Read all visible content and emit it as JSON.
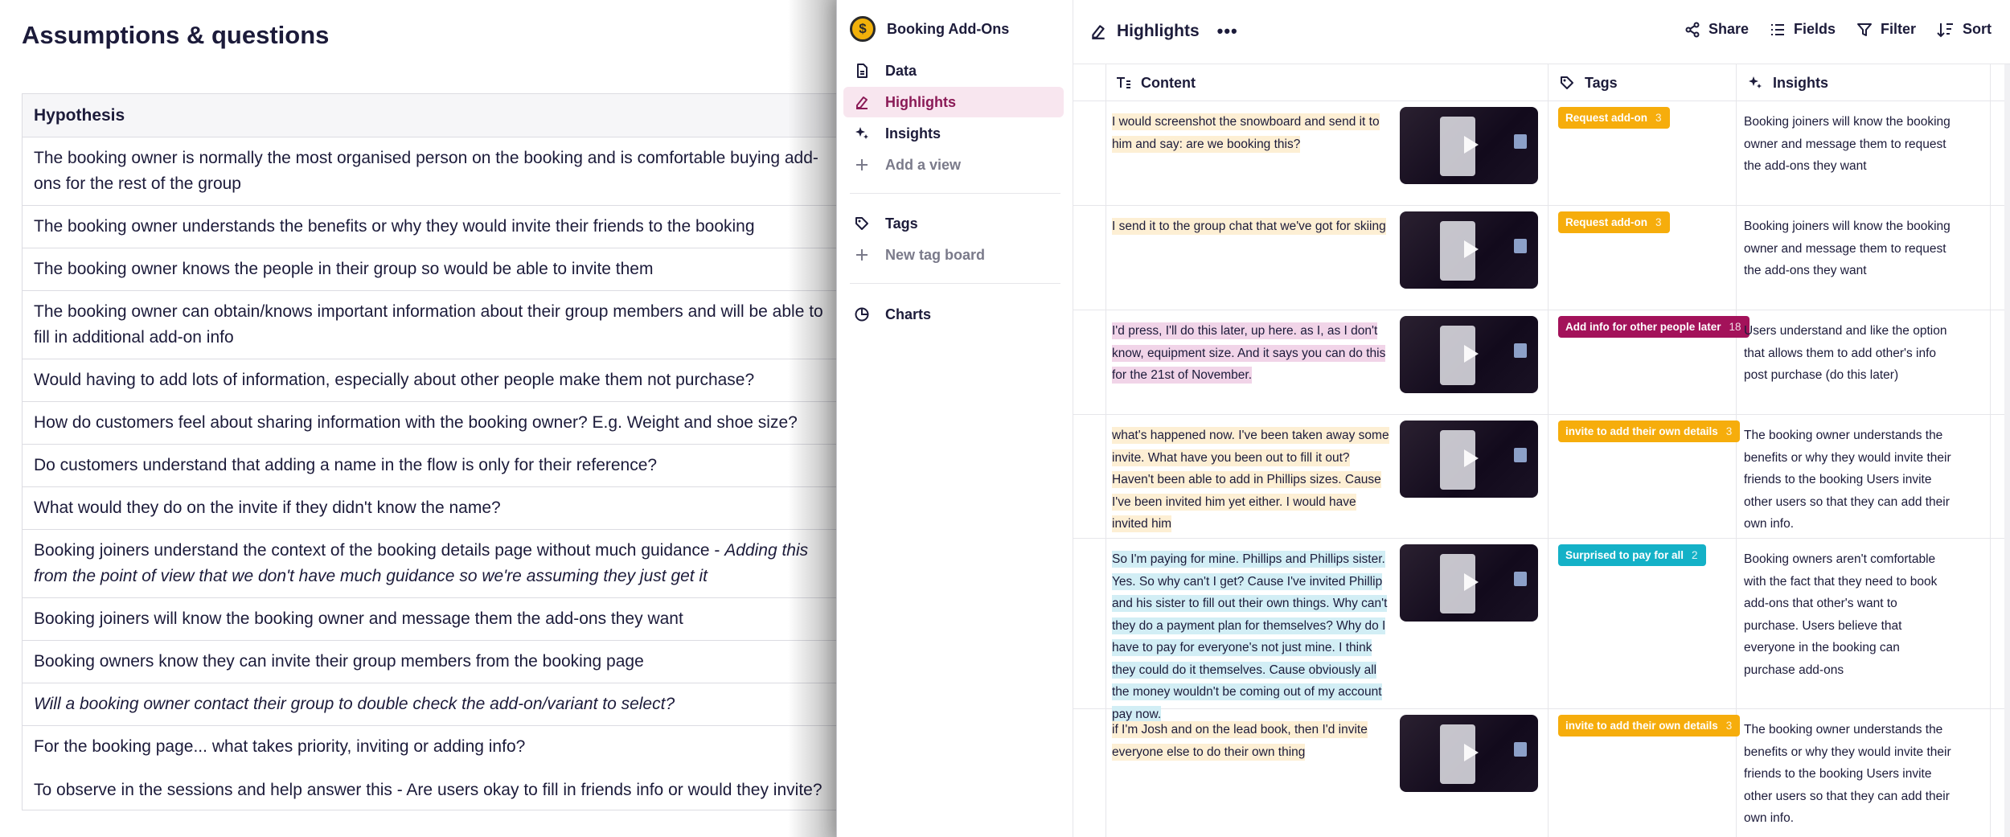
{
  "doc": {
    "title": "Assumptions & questions",
    "table_header": "Hypothesis",
    "rows": [
      {
        "text": "The booking owner is normally the most organised person on the booking and is comfortable buying add-ons for the rest of the group"
      },
      {
        "text": "The booking owner understands the benefits or why they would invite their friends to the booking"
      },
      {
        "text": "The booking owner knows the people in their group so would be able to invite them"
      },
      {
        "text": "The booking owner can obtain/knows important information about their group members and will be able to fill in additional add-on info"
      },
      {
        "text": "Would having to add lots of information, especially about other people make them not purchase?"
      },
      {
        "text": "How do customers feel about sharing information with the booking owner? E.g. Weight and shoe size?"
      },
      {
        "text": "Do customers understand that adding a name in the flow is only for their reference?"
      },
      {
        "text": "What would they do on the invite if they didn't know the name?"
      },
      {
        "text": "Booking joiners understand the context of the booking details page without much guidance - ",
        "em": "Adding this from the point of view that we don't have much guidance so we're assuming they just get it"
      },
      {
        "text": "Booking joiners will know the booking owner and message them the add-ons they want"
      },
      {
        "text": "Booking owners know they can invite their group members from the booking page"
      },
      {
        "text": "Will a booking owner contact their group to double check the add-on/variant to select?",
        "italic": true
      },
      {
        "text": "For the booking page... what takes priority, inviting or adding info?",
        "extra": "To observe in the sessions and help answer this - Are users okay to fill in friends info or would they invite?"
      }
    ]
  },
  "app": {
    "workspace": {
      "logo_glyph": "$",
      "name": "Booking Add-Ons"
    },
    "nav": [
      {
        "label": "Data",
        "icon": "document-icon"
      },
      {
        "label": "Highlights",
        "icon": "highlighter-icon",
        "active": true
      },
      {
        "label": "Insights",
        "icon": "sparkle-icon"
      },
      {
        "label": "Add a view",
        "icon": "plus-icon",
        "muted": true
      }
    ],
    "nav2": [
      {
        "label": "Tags",
        "icon": "tag-icon"
      },
      {
        "label": "New tag board",
        "icon": "plus-icon",
        "muted": true
      }
    ],
    "nav3": [
      {
        "label": "Charts",
        "icon": "pie-chart-icon"
      }
    ],
    "view": {
      "title": "Highlights",
      "more": "•••"
    },
    "actions": {
      "share": "Share",
      "fields": "Fields",
      "filter": "Filter",
      "sort": "Sort"
    },
    "columns": {
      "content": "Content",
      "tags": "Tags",
      "insights": "Insights"
    },
    "highlights": [
      {
        "content": "I would screenshot the snowboard and send it to him and say: are we booking this?",
        "color": "yellow",
        "tag": "Request add-on",
        "tag_count": "3",
        "tag_color": "#f6ad0c",
        "insight": "Booking joiners will know the booking owner and message them to request the add-ons they want"
      },
      {
        "content": "I send it to the group chat that we've got for skiing",
        "color": "yellow",
        "tag": "Request add-on",
        "tag_count": "3",
        "tag_color": "#f6ad0c",
        "insight": "Booking joiners will know the booking owner and message them to request the add-ons they want"
      },
      {
        "content": "I'd press, I'll do this later, up here. as I, as I don't know, equipment size. And it says you can do this for the 21st of November.",
        "color": "pink",
        "tag": "Add info for other people later",
        "tag_count": "18",
        "tag_color": "#a3125a",
        "insight": "Users understand and like the option that allows them to add other's info post purchase (do this later)"
      },
      {
        "content": "what's happened now. I've been taken away some invite. What have you been out to fill it out? Haven't been able to add in Phillips sizes. Cause I've been invited him yet either. I would have invited him",
        "color": "yellow",
        "tag": "invite to add their own details",
        "tag_count": "3",
        "tag_color": "#f6ad0c",
        "insight": "The booking owner understands the benefits or why they would invite their friends to the booking Users invite other users so that they can add their own info."
      },
      {
        "content": "So I'm paying for mine. Phillips and Phillips sister. Yes. So why can't I get? Cause I've invited Phillip and his sister to fill out their own things. Why can't they do a payment plan for themselves? Why do I have to pay for everyone's not just mine. I think they could do it themselves. Cause obviously all the money wouldn't be coming out of my account pay now.",
        "color": "blue",
        "tag": "Surprised to pay for all",
        "tag_count": "2",
        "tag_color": "#14b1c7",
        "insight": "Booking owners aren't comfortable with the fact that they need to book add-ons that other's want to purchase. Users believe that everyone in the booking can purchase add-ons"
      },
      {
        "content": "if I'm Josh and on the lead book, then I'd invite everyone else to do their own thing",
        "color": "yellow",
        "tag": "invite to add their own details",
        "tag_count": "3",
        "tag_color": "#f6ad0c",
        "insight": "The booking owner understands the benefits or why they would invite their friends to the booking Users invite other users so that they can add their own info."
      }
    ]
  }
}
